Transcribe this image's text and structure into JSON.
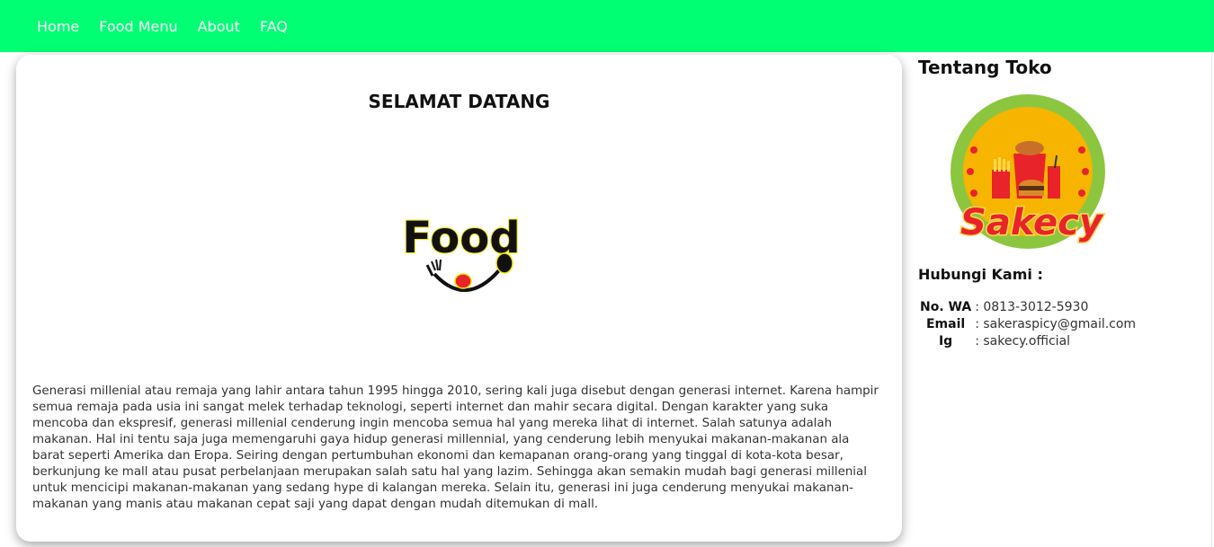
{
  "nav": {
    "items": [
      {
        "label": "Home"
      },
      {
        "label": "Food Menu"
      },
      {
        "label": "About"
      },
      {
        "label": "FAQ"
      }
    ]
  },
  "main": {
    "title": "SELAMAT DATANG",
    "logo_text": "Food",
    "paragraph": "Generasi millenial atau remaja yang lahir antara tahun 1995 hingga 2010, sering kali juga disebut dengan generasi internet. Karena hampir semua remaja pada usia ini sangat melek terhadap teknologi, seperti internet dan mahir secara digital. Dengan karakter yang suka mencoba dan ekspresif, generasi millenial cenderung ingin mencoba semua hal yang mereka lihat di internet. Salah satunya adalah makanan. Hal ini tentu saja juga memengaruhi gaya hidup generasi millennial, yang cenderung lebih menyukai makanan-makanan ala barat seperti Amerika dan Eropa. Seiring dengan pertumbuhan ekonomi dan kemapanan orang-orang yang tinggal di kota-kota besar, berkunjung ke mall atau pusat perbelanjaan merupakan salah satu hal yang lazim. Sehingga akan semakin mudah bagi generasi millenial untuk mencicipi makanan-makanan yang sedang hype di kalangan mereka. Selain itu, generasi ini juga cenderung menyukai makanan-makanan yang manis atau makanan cepat saji yang dapat dengan mudah ditemukan di mall."
  },
  "sidebar": {
    "title": "Tentang Toko",
    "logo_text": "Sakecy",
    "contact_heading": "Hubungi Kami :",
    "contacts": [
      {
        "label": "No. WA",
        "value": ": 0813-3012-5930"
      },
      {
        "label": "Email",
        "value": ": sakeraspicy@gmail.com"
      },
      {
        "label": "Ig",
        "value": ": sakecy.official"
      }
    ]
  },
  "colors": {
    "navbar": "#00ff73",
    "logo_green": "#8cc63f",
    "logo_orange": "#f7b500",
    "logo_red": "#e8242a"
  }
}
